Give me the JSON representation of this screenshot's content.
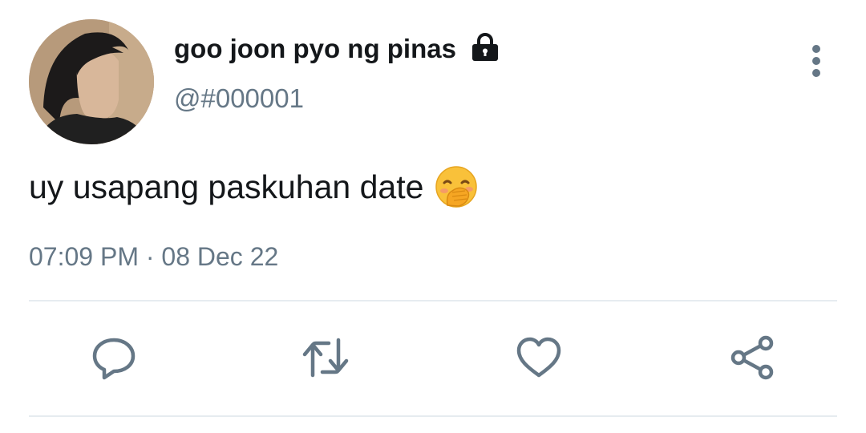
{
  "tweet": {
    "display_name": "goo joon pyo ng pinas",
    "handle": "@#000001",
    "text": "uy usapang paskuhan date",
    "time": "07:09 PM",
    "separator": "·",
    "date": "08 Dec 22",
    "emoji": "face-with-hand-over-mouth",
    "protected_icon": "lock-icon"
  },
  "actions": [
    {
      "name": "reply",
      "icon": "speech-bubble-icon"
    },
    {
      "name": "retweet",
      "icon": "retweet-icon"
    },
    {
      "name": "like",
      "icon": "heart-icon"
    },
    {
      "name": "share",
      "icon": "share-icon"
    }
  ],
  "colors": {
    "text": "#14171a",
    "secondary": "#657786",
    "divider": "#e6ecf0",
    "icon": "#657786"
  }
}
